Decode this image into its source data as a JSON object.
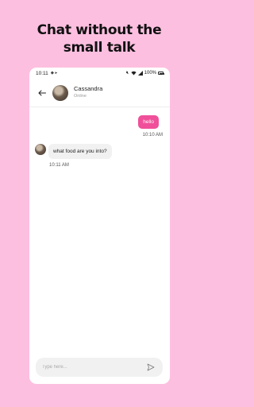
{
  "promo": {
    "headline_line1": "Chat without the",
    "headline_line2": "small talk"
  },
  "statusbar": {
    "time": "10:11",
    "battery": "100%"
  },
  "header": {
    "back_icon": "arrow-left-icon",
    "contact_name": "Cassandra",
    "contact_status": "Online"
  },
  "messages": [
    {
      "direction": "outgoing",
      "text": "hello",
      "time": "10:10 AM"
    },
    {
      "direction": "incoming",
      "text": "what food are you into?",
      "time": "10:11 AM"
    }
  ],
  "composer": {
    "placeholder": "Type here...",
    "send_icon": "send-icon"
  },
  "colors": {
    "background": "#fdbfe0",
    "accent": "#f0509a",
    "incoming_bubble": "#f1f1f1"
  }
}
